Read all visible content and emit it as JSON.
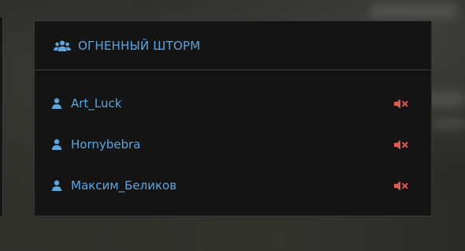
{
  "party": {
    "title": "ОГНЕННЫЙ ШТОРМ",
    "icon": "group-icon",
    "members": [
      {
        "name": "Art_Luck",
        "icon": "user-icon",
        "status_icon": "muted-speaker-icon"
      },
      {
        "name": "Hornybebra",
        "icon": "user-icon",
        "status_icon": "muted-speaker-icon"
      },
      {
        "name": "Максим_Беликов",
        "icon": "user-icon",
        "status_icon": "muted-speaker-icon"
      }
    ]
  },
  "colors": {
    "accent": "#5aa6e0",
    "muted": "#e25a4d",
    "panel": "#141414"
  }
}
